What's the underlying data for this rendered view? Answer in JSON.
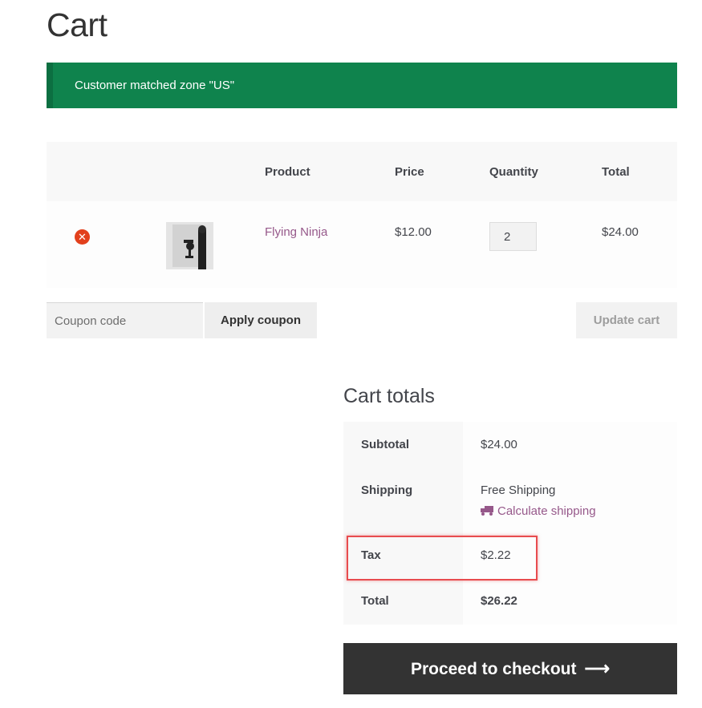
{
  "page": {
    "title": "Cart"
  },
  "notice": {
    "text": "Customer matched zone \"US\""
  },
  "cart_table": {
    "headers": {
      "product": "Product",
      "price": "Price",
      "quantity": "Quantity",
      "total": "Total"
    },
    "items": [
      {
        "name": "Flying Ninja",
        "price": "$12.00",
        "quantity": "2",
        "total": "$24.00",
        "remove_icon": "remove-icon",
        "remove_glyph": "✕"
      }
    ]
  },
  "actions": {
    "coupon_placeholder": "Coupon code",
    "apply_label": "Apply coupon",
    "update_label": "Update cart"
  },
  "totals": {
    "title": "Cart totals",
    "subtotal_label": "Subtotal",
    "subtotal_value": "$24.00",
    "shipping_label": "Shipping",
    "shipping_value": "Free Shipping",
    "calc_shipping": "Calculate shipping",
    "tax_label": "Tax",
    "tax_value": "$2.22",
    "total_label": "Total",
    "total_value": "$26.22"
  },
  "checkout": {
    "label": "Proceed to checkout",
    "arrow": "⟶"
  },
  "colors": {
    "notice_bg": "#0f834d",
    "link": "#96588a",
    "remove": "#e2401c",
    "checkout_bg": "#333333",
    "highlight": "#e84c4f"
  }
}
